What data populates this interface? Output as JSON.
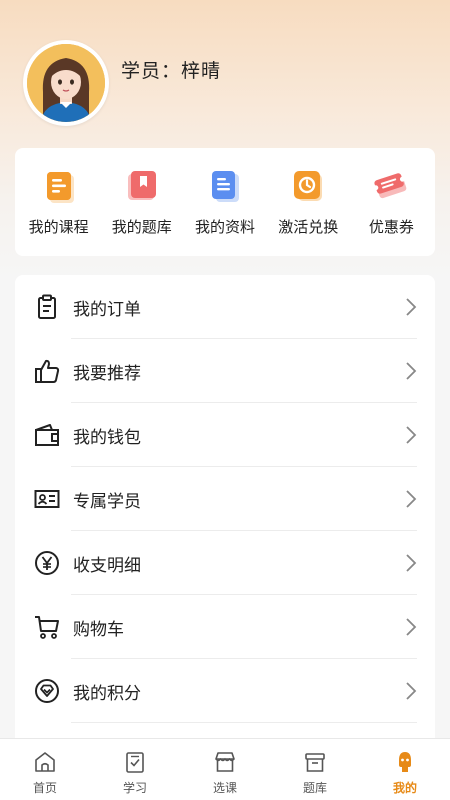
{
  "profile": {
    "avatar_icon": "girl-avatar-icon",
    "username": "学员：梓晴"
  },
  "quick_actions": [
    {
      "label": "我的课程",
      "icon": "course-icon"
    },
    {
      "label": "我的题库",
      "icon": "question-bank-icon"
    },
    {
      "label": "我的资料",
      "icon": "document-icon"
    },
    {
      "label": "激活兑换",
      "icon": "activate-icon"
    },
    {
      "label": "优惠券",
      "icon": "coupon-icon"
    }
  ],
  "menu": [
    {
      "label": "我的订单",
      "icon": "clipboard-icon"
    },
    {
      "label": "我要推荐",
      "icon": "thumbs-up-icon"
    },
    {
      "label": "我的钱包",
      "icon": "wallet-icon"
    },
    {
      "label": "专属学员",
      "icon": "id-card-icon"
    },
    {
      "label": "收支明细",
      "icon": "yen-icon"
    },
    {
      "label": "购物车",
      "icon": "cart-icon"
    },
    {
      "label": "我的积分",
      "icon": "points-icon"
    },
    {
      "label": "",
      "icon": "partially-hidden-icon"
    }
  ],
  "tabs": [
    {
      "label": "首页",
      "icon": "home-icon",
      "active": false
    },
    {
      "label": "学习",
      "icon": "study-icon",
      "active": false
    },
    {
      "label": "选课",
      "icon": "store-icon",
      "active": false
    },
    {
      "label": "题库",
      "icon": "archive-icon",
      "active": false
    },
    {
      "label": "我的",
      "icon": "profile-icon",
      "active": true
    }
  ],
  "colors": {
    "accent": "#e78a17",
    "header_gradient_top": "#f7dcc0"
  }
}
